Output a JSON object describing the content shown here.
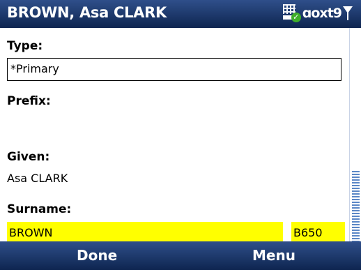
{
  "title_bar": {
    "title": "BROWN, Asa CLARK",
    "input_mode": "ɑoxt9"
  },
  "form": {
    "type_label": "Type:",
    "type_value": "*Primary",
    "prefix_label": "Prefix:",
    "prefix_value": "",
    "given_label": "Given:",
    "given_value": "Asa CLARK",
    "surname_label": "Surname:",
    "surname_value": "BROWN",
    "surname_code": "B650"
  },
  "softkeys": {
    "left": "Done",
    "right": "Menu"
  },
  "colors": {
    "bar_blue": "#1a3466",
    "highlight": "#ffff00",
    "scroll": "#5b87c6"
  }
}
